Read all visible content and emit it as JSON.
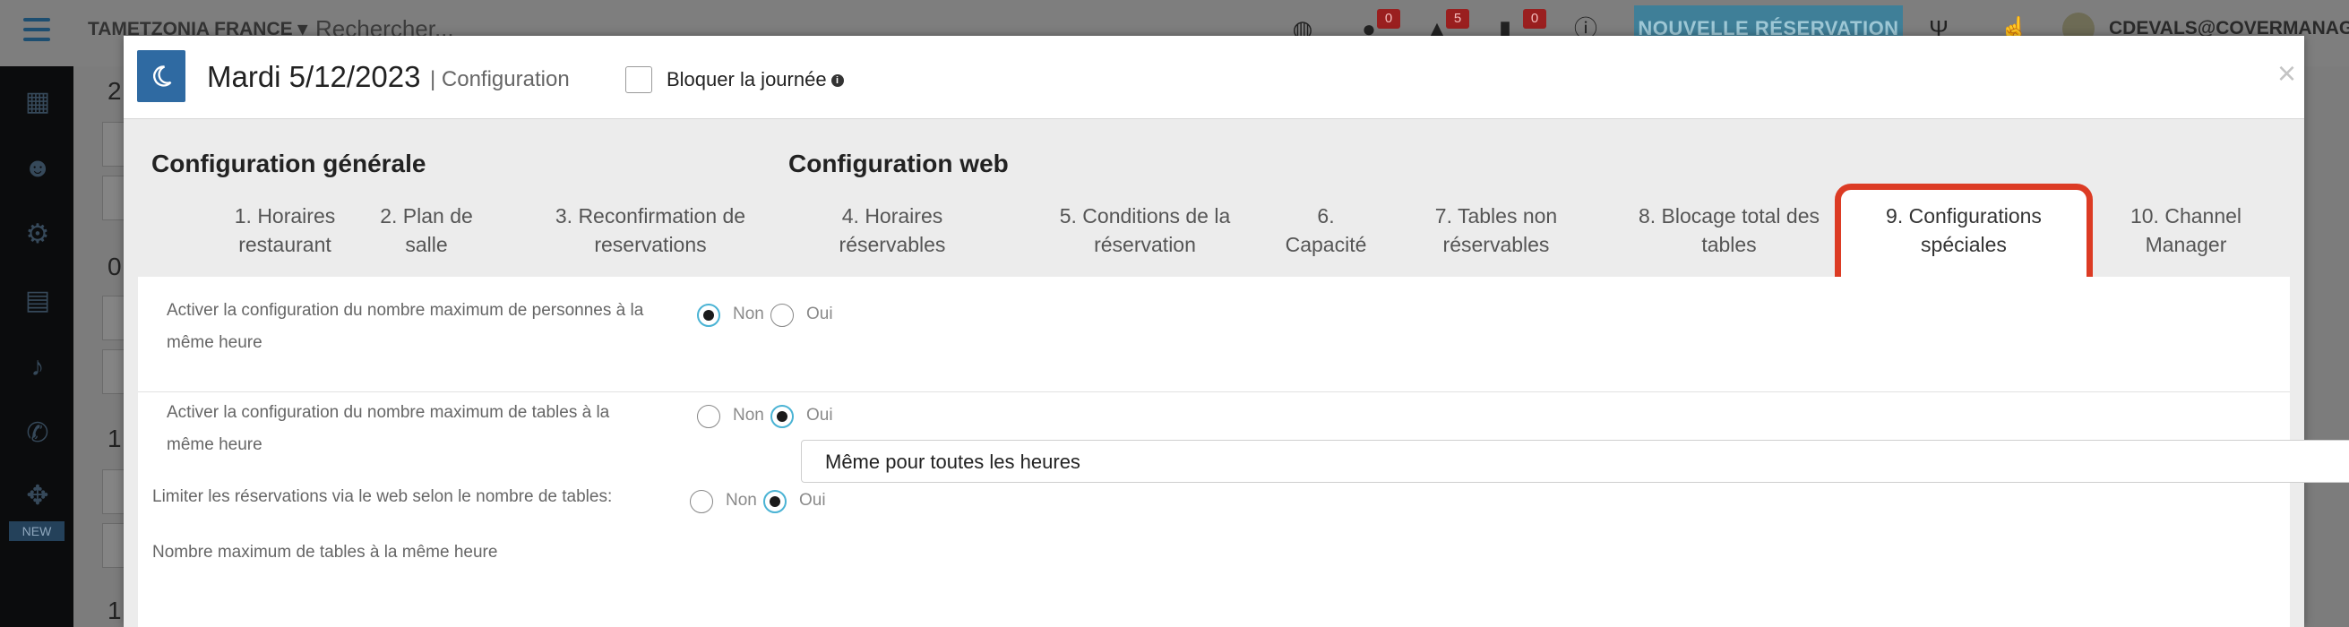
{
  "topbar": {
    "venue": "TAMETZONIA FRANCE",
    "search_placeholder": "Rechercher...",
    "badges": [
      "0",
      "5",
      "0"
    ],
    "new_reservation": "NOUVELLE RÉSERVATION",
    "user": "CDEVALS@COVERMANAGER"
  },
  "sidebar": {
    "icons": [
      "calendar-icon",
      "smiley-icon",
      "gear-icon",
      "chart-icon",
      "bell-icon",
      "phone-icon",
      "puzzle-icon"
    ],
    "new_tag": "NEW"
  },
  "background": {
    "row_numbers": [
      "2",
      "0",
      "1",
      "1"
    ]
  },
  "modal": {
    "date": "Mardi 5/12/2023",
    "subtitle": "| Configuration",
    "block_day_label": "Bloquer la journée",
    "block_day_checked": false,
    "close": "×"
  },
  "sections": {
    "general": "Configuration générale",
    "web": "Configuration web"
  },
  "tabs": [
    {
      "line1": "1. Horaires",
      "line2": "restaurant",
      "active": false
    },
    {
      "line1": "2. Plan de",
      "line2": "salle",
      "active": false
    },
    {
      "line1": "3. Reconfirmation de",
      "line2": "reservations",
      "active": false
    },
    {
      "line1": "4. Horaires",
      "line2": "réservables",
      "active": false
    },
    {
      "line1": "5. Conditions de la",
      "line2": "réservation",
      "active": false
    },
    {
      "line1": "6.",
      "line2": "Capacité",
      "active": false
    },
    {
      "line1": "7. Tables non",
      "line2": "réservables",
      "active": false
    },
    {
      "line1": "8. Blocage total des",
      "line2": "tables",
      "active": false
    },
    {
      "line1": "9. Configurations",
      "line2": "spéciales",
      "active": true
    },
    {
      "line1": "10. Channel",
      "line2": "Manager",
      "active": false
    }
  ],
  "settings": {
    "max_persons": {
      "label_line1": "Activer la configuration du nombre maximum de personnes à la",
      "label_line2": "même heure",
      "no": "Non",
      "yes": "Oui",
      "value": "Non"
    },
    "max_tables": {
      "label_line1": "Activer la configuration du nombre maximum de tables à la",
      "label_line2": "même heure",
      "no": "Non",
      "yes": "Oui",
      "value": "Oui"
    },
    "limit_web": {
      "label": "Limiter les réservations via le web selon le nombre de tables:",
      "no": "Non",
      "yes": "Oui",
      "value": "Oui"
    },
    "max_tables_same_hour": {
      "label": "Nombre maximum de tables à la même heure",
      "selected": "Même pour toutes les heures"
    }
  },
  "colors": {
    "accent": "#2f6aa2",
    "highlight": "#dc3b24",
    "radio_ring": "#4ab3d4"
  }
}
